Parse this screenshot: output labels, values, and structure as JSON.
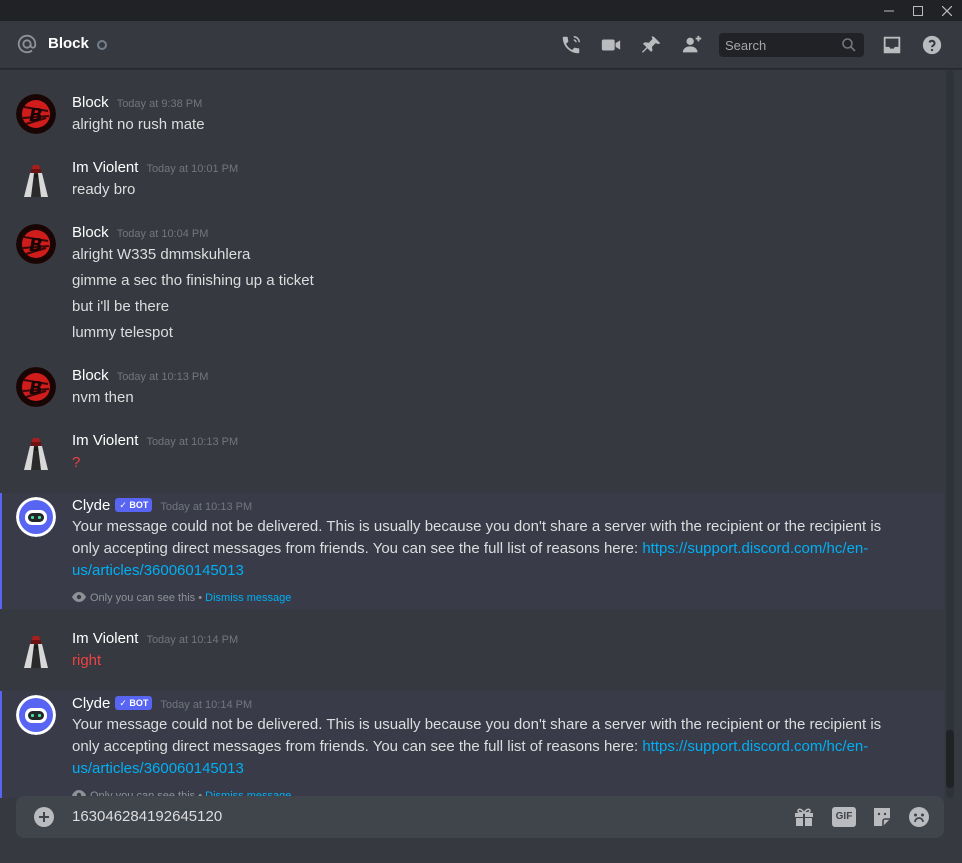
{
  "window": {
    "minimize": "—",
    "maximize": "☐",
    "close": "✕"
  },
  "header": {
    "title": "Block",
    "search_placeholder": "Search",
    "icons": [
      "at-icon",
      "call-icon",
      "video-icon",
      "pin-icon",
      "add-friend-icon",
      "search-icon",
      "inbox-icon",
      "help-icon"
    ]
  },
  "messages": [
    {
      "author": "Block",
      "time": "Today at 9:38 PM",
      "lines": [
        "alright no rush mate"
      ]
    },
    {
      "author": "Im Violent",
      "time": "Today at 10:01 PM",
      "lines": [
        "ready bro"
      ]
    },
    {
      "author": "Block",
      "time": "Today at 10:04 PM",
      "lines": [
        "alright W335 dmmskuhlera",
        "gimme a sec tho finishing up a ticket",
        "but i'll be there",
        "lummy telespot"
      ]
    },
    {
      "author": "Block",
      "time": "Today at 10:13 PM",
      "lines": [
        "nvm then"
      ]
    },
    {
      "author": "Im Violent",
      "time": "Today at 10:13 PM",
      "lines": [
        "?"
      ]
    },
    {
      "author": "Clyde",
      "bot_tag": "BOT",
      "time": "Today at 10:13 PM",
      "text": "Your message could not be delivered. This is usually because you don't share a server with the recipient or the recipient is only accepting direct messages from friends. You can see the full list of reasons here: ",
      "link": "https://support.discord.com/hc/en-us/articles/360060145013",
      "note": "Only you can see this • ",
      "dismiss": "Dismiss message"
    },
    {
      "author": "Im Violent",
      "time": "Today at 10:14 PM",
      "lines": [
        "right"
      ]
    },
    {
      "author": "Clyde",
      "bot_tag": "BOT",
      "time": "Today at 10:14 PM",
      "text": "Your message could not be delivered. This is usually because you don't share a server with the recipient or the recipient is only accepting direct messages from friends. You can see the full list of reasons here: ",
      "link": "https://support.discord.com/hc/en-us/articles/360060145013",
      "note": "Only you can see this • ",
      "dismiss": "Dismiss message"
    }
  ],
  "composer": {
    "value": "163046284192645120",
    "gif_label": "GIF",
    "icons": [
      "plus-icon",
      "gift-icon",
      "gif-icon",
      "sticker-icon",
      "emoji-icon"
    ]
  },
  "colors": {
    "background": "#36393f",
    "link": "#00aff4",
    "bot_tag": "#5865f2",
    "error_text": "#ed4245"
  }
}
